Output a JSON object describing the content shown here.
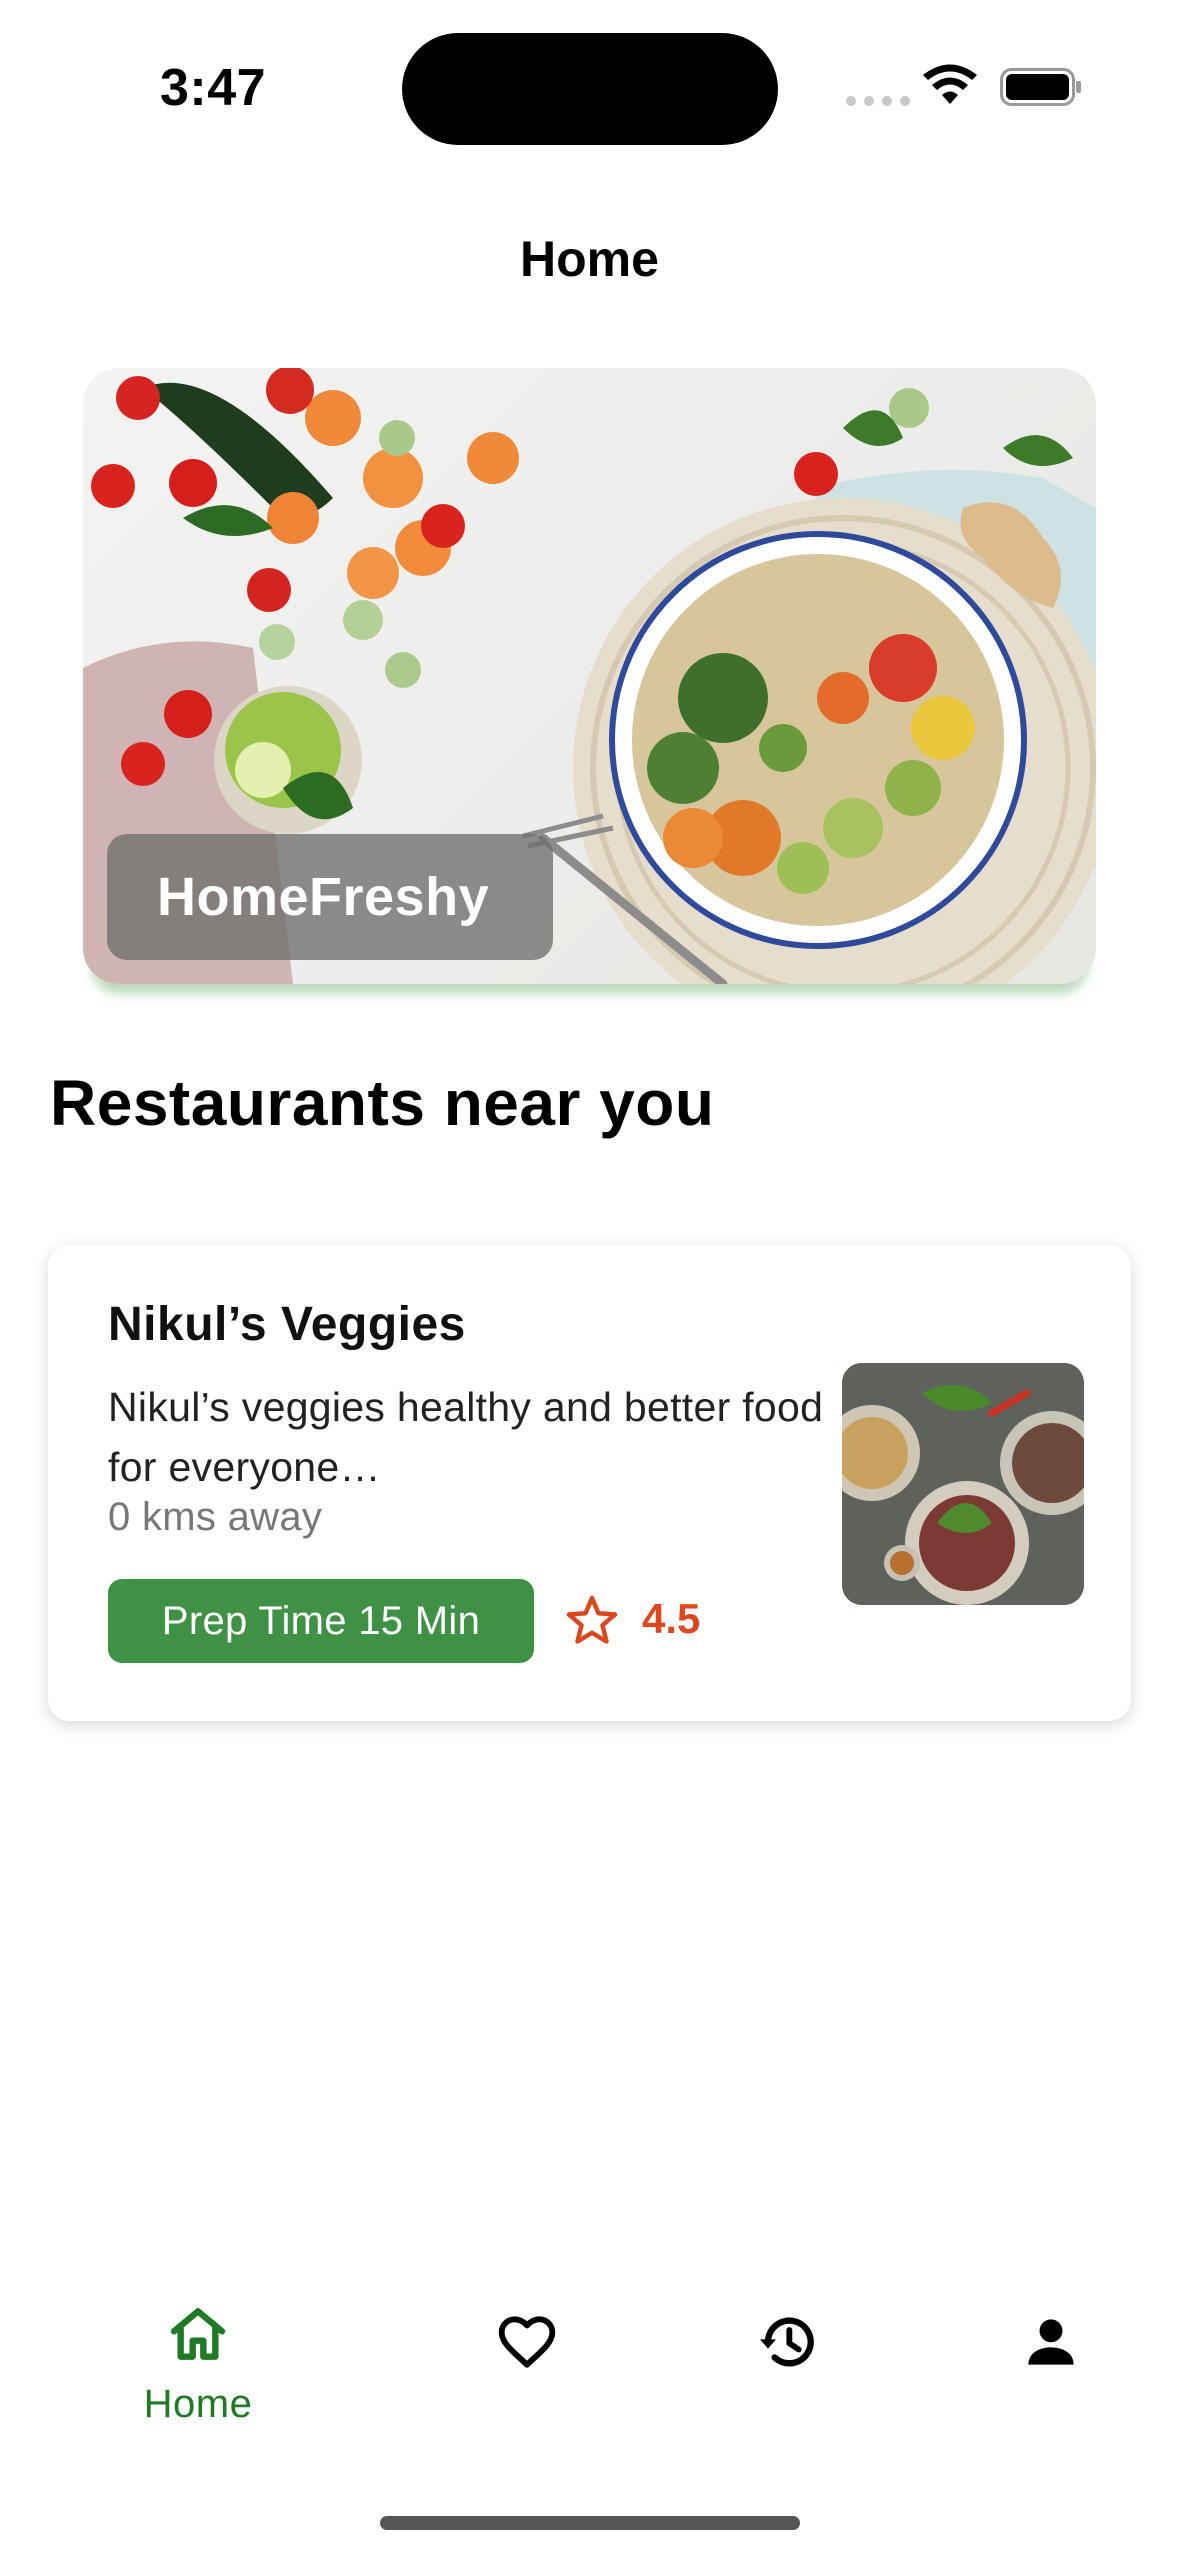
{
  "status_bar": {
    "time": "3:47",
    "icons": [
      "cellular-signal-icon",
      "wifi-icon",
      "battery-icon"
    ]
  },
  "header": {
    "title": "Home"
  },
  "hero": {
    "label": "HomeFreshy",
    "image": "vegetables-and-salad-bowl-photo"
  },
  "section": {
    "title": "Restaurants near you"
  },
  "restaurants": [
    {
      "name": "Nikul’s Veggies",
      "description": "Nikul’s veggies healthy and better food for everyone…",
      "distance": "0 kms away",
      "prep_time": "Prep Time 15 Min",
      "rating": "4.5",
      "image": "dishes-on-table-photo"
    }
  ],
  "bottom_nav": {
    "items": [
      {
        "label": "Home",
        "icon": "home-icon",
        "active": true
      },
      {
        "label": "",
        "icon": "heart-icon",
        "active": false
      },
      {
        "label": "",
        "icon": "history-icon",
        "active": false
      },
      {
        "label": "",
        "icon": "profile-icon",
        "active": false
      }
    ]
  },
  "colors": {
    "accent_green": "#3f9145",
    "nav_active": "#1e7a24",
    "rating": "#d9481e"
  }
}
